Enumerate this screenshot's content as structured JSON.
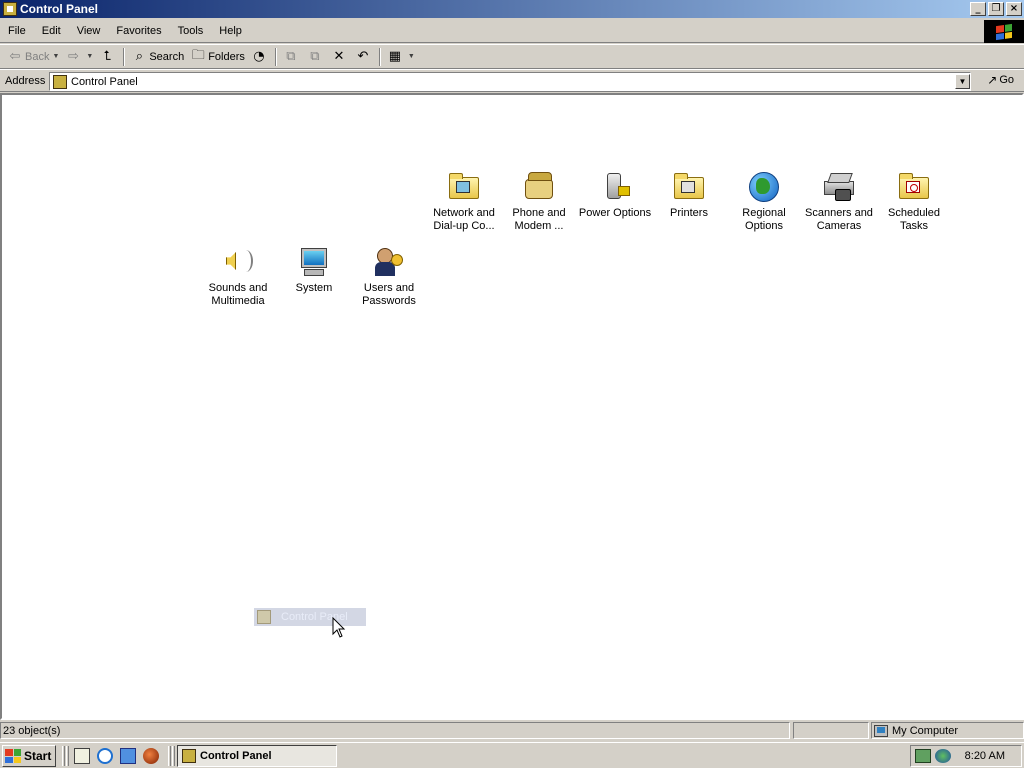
{
  "window": {
    "title": "Control Panel",
    "controls": {
      "minimize": "_",
      "restore": "❐",
      "close": "×"
    }
  },
  "menu": [
    "File",
    "Edit",
    "View",
    "Favorites",
    "Tools",
    "Help"
  ],
  "toolbar": {
    "back_label": "Back",
    "search_label": "Search",
    "folders_label": "Folders"
  },
  "address": {
    "label": "Address",
    "value": "Control Panel",
    "go_label": "Go"
  },
  "items": [
    {
      "label1": "Network and",
      "label2": "Dial-up Co...",
      "icon": "network-connections-icon"
    },
    {
      "label1": "Phone and",
      "label2": "Modem ...",
      "icon": "phone-modem-icon"
    },
    {
      "label1": "Power Options",
      "label2": "",
      "icon": "power-options-icon"
    },
    {
      "label1": "Printers",
      "label2": "",
      "icon": "printers-icon"
    },
    {
      "label1": "Regional",
      "label2": "Options",
      "icon": "globe-icon"
    },
    {
      "label1": "Scanners and",
      "label2": "Cameras",
      "icon": "scanner-camera-icon"
    },
    {
      "label1": "Scheduled",
      "label2": "Tasks",
      "icon": "scheduled-tasks-icon"
    },
    {
      "label1": "Sounds and",
      "label2": "Multimedia",
      "icon": "speaker-icon"
    },
    {
      "label1": "System",
      "label2": "",
      "icon": "computer-icon"
    },
    {
      "label1": "Users and",
      "label2": "Passwords",
      "icon": "users-key-icon"
    }
  ],
  "drag_ghost": {
    "label": "Control Panel"
  },
  "status": {
    "objects": "23 object(s)",
    "zone": "My Computer"
  },
  "taskbar": {
    "start_label": "Start",
    "task_label": "Control Panel",
    "clock": "8:20 AM"
  }
}
